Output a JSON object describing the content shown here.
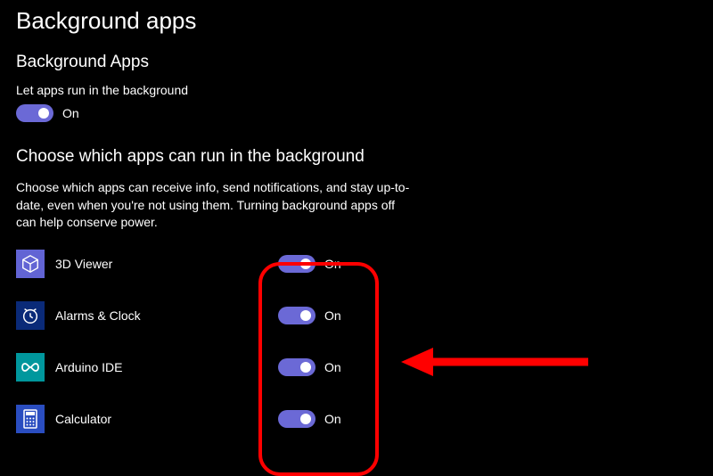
{
  "page_title": "Background apps",
  "master": {
    "heading": "Background Apps",
    "label": "Let apps run in the background",
    "state": "On"
  },
  "choose": {
    "heading": "Choose which apps can run in the background",
    "description": "Choose which apps can receive info, send notifications, and stay up-to-date, even when you're not using them. Turning background apps off can help conserve power."
  },
  "apps": [
    {
      "name": "3D Viewer",
      "state": "On",
      "icon_bg": "#6264d4",
      "icon": "cube"
    },
    {
      "name": "Alarms & Clock",
      "state": "On",
      "icon_bg": "#0a2a78",
      "icon": "clock"
    },
    {
      "name": "Arduino IDE",
      "state": "On",
      "icon_bg": "#00979d",
      "icon": "infinity"
    },
    {
      "name": "Calculator",
      "state": "On",
      "icon_bg": "#2a4dc0",
      "icon": "calc"
    }
  ],
  "colors": {
    "accent": "#6b69d6",
    "annotation": "#ff0000"
  }
}
